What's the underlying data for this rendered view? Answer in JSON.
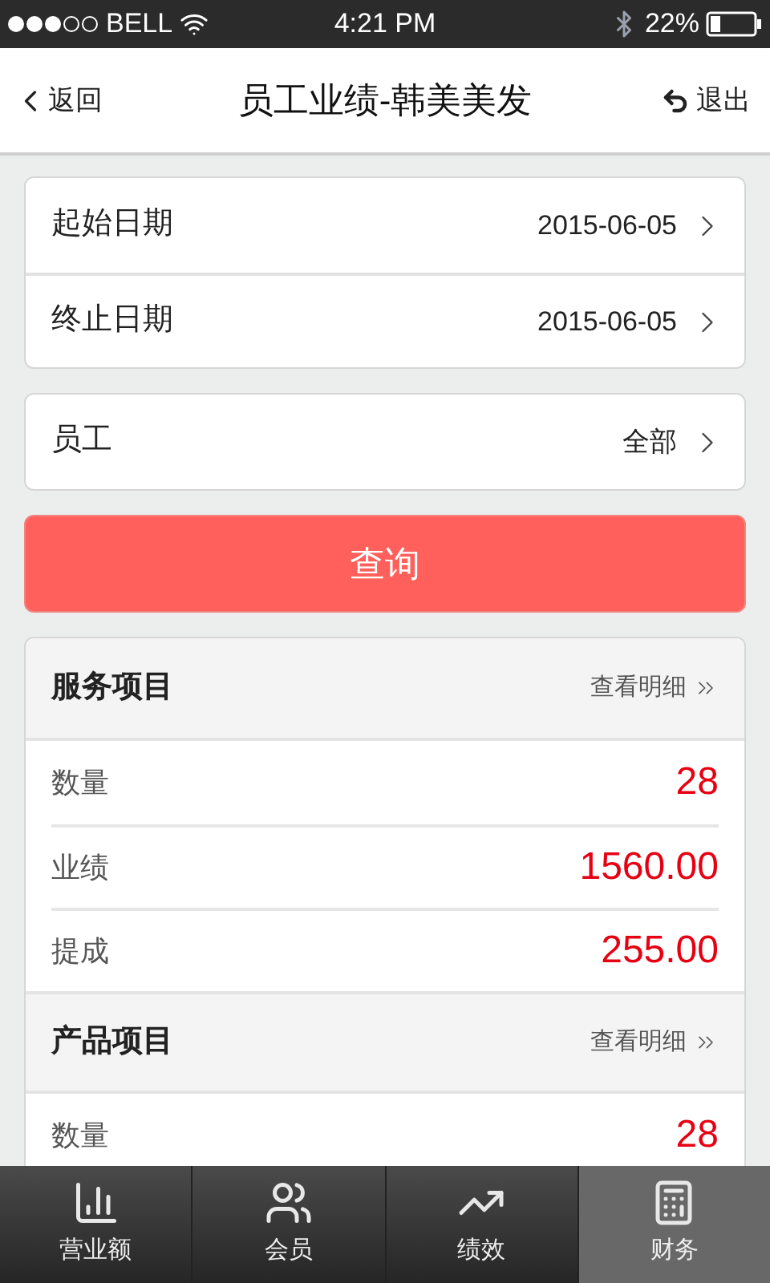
{
  "status_bar": {
    "carrier": "BELL",
    "time": "4:21 PM",
    "battery": "22%"
  },
  "nav": {
    "back": "返回",
    "title": "员工业绩-韩美美发",
    "exit": "退出"
  },
  "filter_groups": [
    [
      {
        "label": "起始日期",
        "value": "2015-06-05"
      },
      {
        "label": "终止日期",
        "value": "2015-06-05"
      }
    ],
    [
      {
        "label": "员工",
        "value": "全部"
      }
    ]
  ],
  "query_button": "查询",
  "sections": [
    {
      "title": "服务项目",
      "detail_link": "查看明细",
      "rows": [
        {
          "label": "数量",
          "value": "28"
        },
        {
          "label": "业绩",
          "value": "1560.00"
        },
        {
          "label": "提成",
          "value": "255.00"
        }
      ]
    },
    {
      "title": "产品项目",
      "detail_link": "查看明细",
      "rows": [
        {
          "label": "数量",
          "value": "28"
        }
      ]
    }
  ],
  "tabs": [
    {
      "label": "营业额",
      "kind": "revenue",
      "selected": false
    },
    {
      "label": "会员",
      "kind": "members",
      "selected": false
    },
    {
      "label": "绩效",
      "kind": "performance",
      "selected": false
    },
    {
      "label": "财务",
      "kind": "finance",
      "selected": true
    }
  ]
}
